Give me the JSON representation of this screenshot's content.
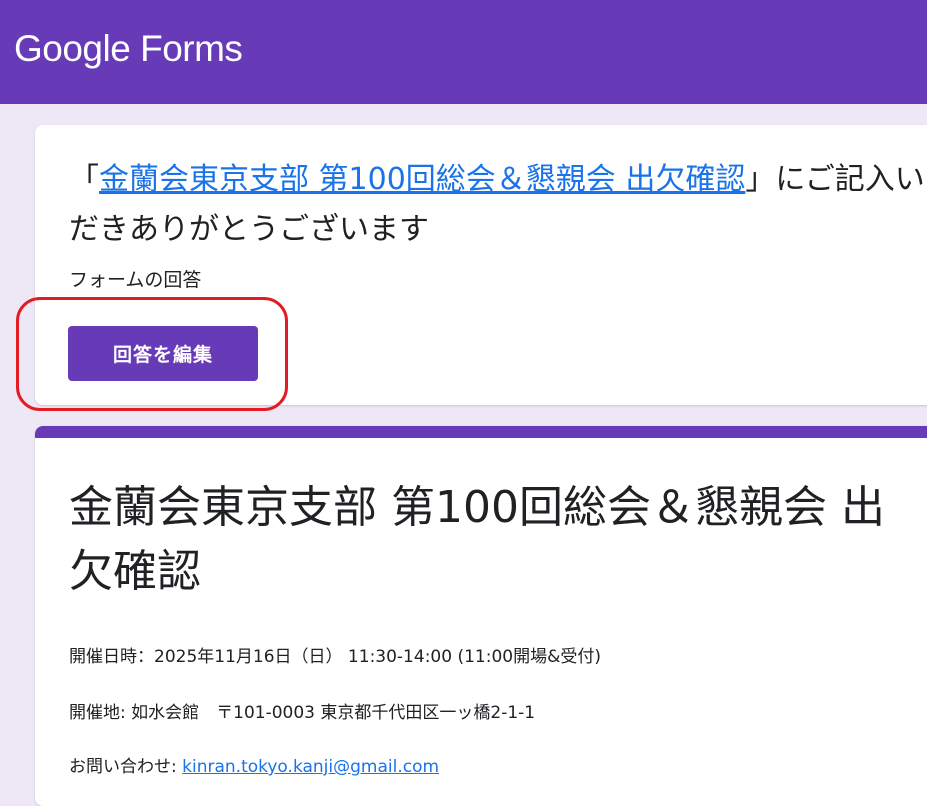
{
  "header": {
    "brand": "Google Forms"
  },
  "confirmation": {
    "prefix": "「",
    "form_link_text": "金蘭会東京支部 第100回総会＆懇親会 出欠確認",
    "suffix_line1": "」にご記入いた",
    "line2": "だきありがとうございます",
    "responses_label": "フォームの回答",
    "edit_button_label": "回答を編集"
  },
  "form": {
    "title_line1": "金蘭会東京支部 第100回総会＆懇親会 出",
    "title_line2": "欠確認",
    "datetime": "開催日時：2025年11月16日（日） 11:30-14:00 (11:00開場&受付)",
    "venue": "開催地: 如水会館　〒101-0003 東京都千代田区一ッ橋2-1-1",
    "contact_label": "お問い合わせ: ",
    "contact_email": "kinran.tokyo.kanji@gmail.com"
  },
  "colors": {
    "brand_purple": "#673ab7",
    "background": "#ede7f6",
    "link_blue": "#1a73e8",
    "highlight_red": "#e31b23"
  }
}
